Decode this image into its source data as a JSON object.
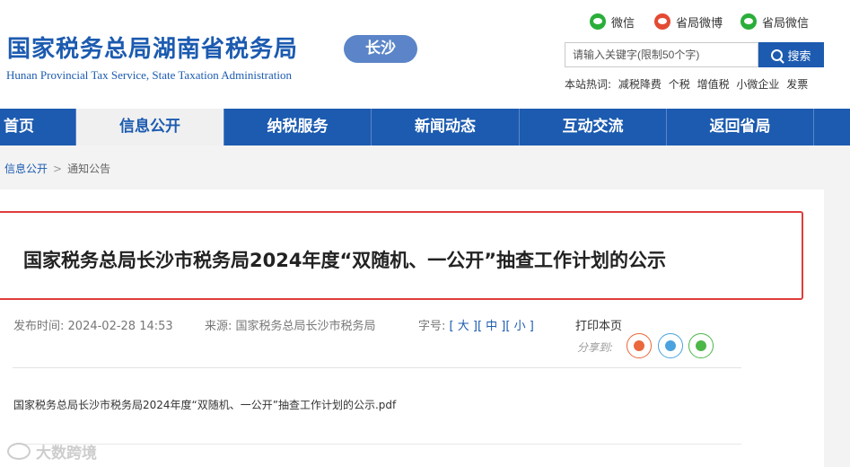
{
  "header": {
    "logo_cn": "国家税务总局湖南省税务局",
    "city": "长沙",
    "logo_en": "Hunan Provincial  Tax Service,  State Taxation Administration",
    "social": [
      {
        "label": "微信",
        "icon": "wechat-icon",
        "color": "#2aae3a"
      },
      {
        "label": "省局微博",
        "icon": "weibo-icon",
        "color": "#e44a33"
      },
      {
        "label": "省局微信",
        "icon": "wechat-icon",
        "color": "#2aae3a"
      }
    ],
    "search": {
      "placeholder": "请输入关键字(限制50个字)",
      "button": "搜索"
    },
    "hotwords": {
      "label": "本站热词:",
      "items": [
        "减税降费",
        "个税",
        "增值税",
        "小微企业",
        "发票"
      ]
    }
  },
  "nav": {
    "items": [
      "首页",
      "信息公开",
      "纳税服务",
      "新闻动态",
      "互动交流",
      "返回省局"
    ],
    "active": "信息公开"
  },
  "breadcrumb": {
    "link": "信息公开",
    "separator": ">",
    "current": "通知公告"
  },
  "article": {
    "title": "国家税务总局长沙市税务局2024年度“双随机、一公开”抽查工作计划的公示",
    "publish_label": "发布时间:",
    "publish_time": "2024-02-28 14:53",
    "source_label": "来源:",
    "source": "国家税务总局长沙市税务局",
    "fontsize": {
      "label": "字号:",
      "large": "[ 大 ]",
      "medium": "[ 中 ]",
      "small": "[ 小 ]"
    },
    "print": "打印本页",
    "share_label": "分享到:",
    "attachment": "国家税务总局长沙市税务局2024年度“双随机、一公开”抽查工作计划的公示.pdf"
  },
  "watermark": "大数跨境",
  "colors": {
    "brand": "#1c5bb0",
    "highlight": "#e03c3c",
    "pill": "#5b85c8"
  }
}
